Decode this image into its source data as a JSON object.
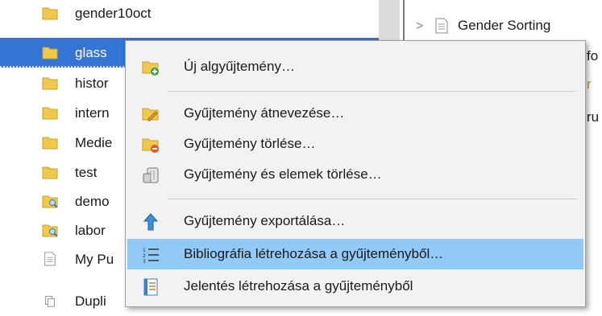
{
  "tree": {
    "items": [
      {
        "label": "gender10oct",
        "icon": "folder-icon"
      },
      {
        "label": "glass",
        "icon": "folder-icon"
      },
      {
        "label": "histor",
        "icon": "folder-icon"
      },
      {
        "label": "intern",
        "icon": "folder-icon"
      },
      {
        "label": "Medie",
        "icon": "folder-icon"
      },
      {
        "label": "test",
        "icon": "folder-icon"
      },
      {
        "label": "demo",
        "icon": "saved-search-icon"
      },
      {
        "label": "labor",
        "icon": "saved-search-icon"
      },
      {
        "label": "My Pu",
        "icon": "document-icon"
      },
      {
        "label": "Dupli",
        "icon": "duplicates-icon"
      }
    ]
  },
  "right_pane": {
    "row_title": "Gender Sorting",
    "frag1": "fo",
    "frag2": "r",
    "frag3": "ru"
  },
  "menu": {
    "items": [
      {
        "label": "Új algyűjtemény…",
        "icon": "new-subcollection-icon"
      },
      {
        "label": "Gyűjtemény átnevezése…",
        "icon": "rename-collection-icon"
      },
      {
        "label": "Gyűjtemény törlése…",
        "icon": "delete-collection-icon"
      },
      {
        "label": "Gyűjtemény és elemek törlése…",
        "icon": "trash-can-icon"
      },
      {
        "label": "Gyűjtemény exportálása…",
        "icon": "export-arrow-icon"
      },
      {
        "label": "Bibliográfia létrehozása a gyűjteményből…",
        "icon": "numbered-list-icon"
      },
      {
        "label": "Jelentés létrehozása a gyűjteményből",
        "icon": "report-icon"
      }
    ]
  },
  "colors": {
    "selection": "#3374d4",
    "menu_highlight": "#91c9f7",
    "folder": "#f0c94a"
  }
}
